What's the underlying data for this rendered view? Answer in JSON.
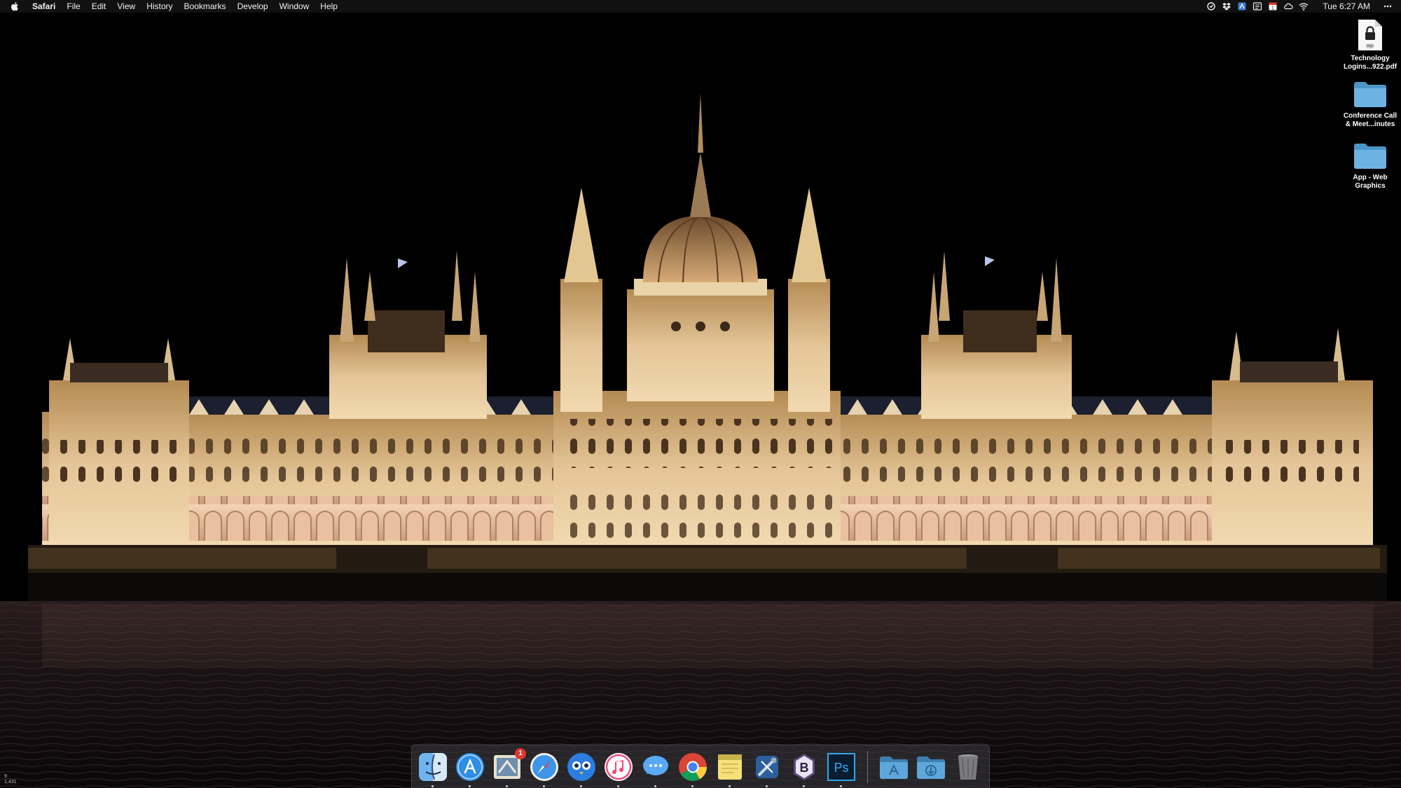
{
  "menubar": {
    "app_name": "Safari",
    "menus": [
      "File",
      "Edit",
      "View",
      "History",
      "Bookmarks",
      "Develop",
      "Window",
      "Help"
    ],
    "status_icons": [
      "sync-icon",
      "dropbox-icon",
      "app-icon",
      "news-icon",
      "calendar-icon",
      "cloud-icon",
      "wifi-icon",
      "more-icon"
    ],
    "calendar_day": "1",
    "clock": "Tue 6:27 AM"
  },
  "desktop": {
    "icons": [
      {
        "label_line1": "Technology",
        "label_line2": "Logins...922.pdf",
        "kind": "pdf-lock-icon"
      },
      {
        "label_line1": "Conference Call",
        "label_line2": "& Meet...inutes",
        "kind": "folder-icon"
      },
      {
        "label_line1": "App - Web",
        "label_line2": "Graphics",
        "kind": "folder-icon"
      }
    ],
    "pdf_tag": "PDF"
  },
  "dock": {
    "apps": [
      "Finder",
      "App Store",
      "Mail",
      "Safari",
      "Tweetbot",
      "iTunes",
      "Messages",
      "Chrome",
      "Notes",
      "Xcode",
      "BBEdit",
      "Photoshop"
    ],
    "mail_badge": "1",
    "photoshop_label": "Ps",
    "bbedit_label": "B",
    "stacks": [
      "Applications",
      "Downloads",
      "Trash"
    ]
  },
  "corner_readout": [
    "9",
    "1,431"
  ],
  "colors": {
    "sky": "#000000",
    "building_light": "#e8cfa0",
    "water": "#150f12",
    "folder_blue": "#5fa8d8"
  }
}
